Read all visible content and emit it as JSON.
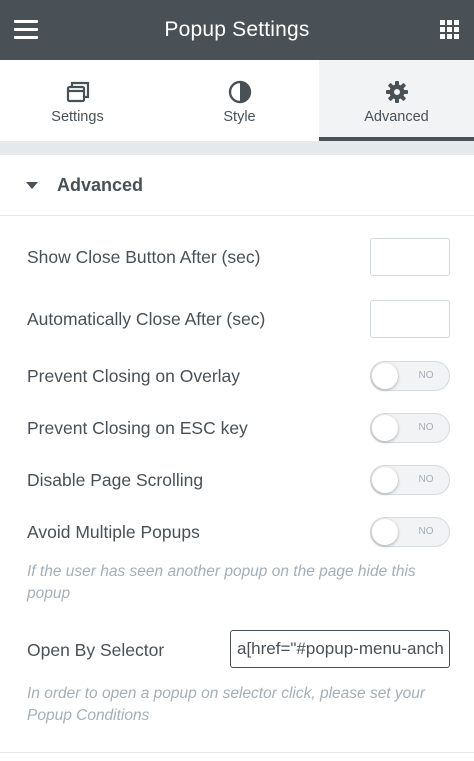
{
  "header": {
    "title": "Popup Settings",
    "menu_icon": "hamburger-icon",
    "apps_icon": "grid-icon",
    "background_color": "#495157"
  },
  "tabs": [
    {
      "label": "Settings",
      "icon": "window-icon",
      "active": false
    },
    {
      "label": "Style",
      "icon": "contrast-icon",
      "active": false
    },
    {
      "label": "Advanced",
      "icon": "gear-icon",
      "active": true
    }
  ],
  "section": {
    "title": "Advanced",
    "caret_icon": "caret-down-icon",
    "expanded": true
  },
  "fields": {
    "show_close_after": {
      "label": "Show Close Button After (sec)",
      "value": ""
    },
    "auto_close_after": {
      "label": "Automatically Close After (sec)",
      "value": ""
    },
    "prevent_overlay": {
      "label": "Prevent Closing on Overlay",
      "toggle_text": "NO",
      "on": false
    },
    "prevent_esc": {
      "label": "Prevent Closing on ESC key",
      "toggle_text": "NO",
      "on": false
    },
    "disable_scroll": {
      "label": "Disable Page Scrolling",
      "toggle_text": "NO",
      "on": false
    },
    "avoid_multiple": {
      "label": "Avoid Multiple Popups",
      "toggle_text": "NO",
      "on": false
    },
    "avoid_multiple_desc": "If the user has seen another popup on the page hide this popup",
    "open_by_selector": {
      "label": "Open By Selector",
      "value": "a[href=\"#popup-menu-anchor\"]"
    },
    "open_by_selector_desc": "In order to open a popup on selector click, please set your Popup Conditions"
  }
}
